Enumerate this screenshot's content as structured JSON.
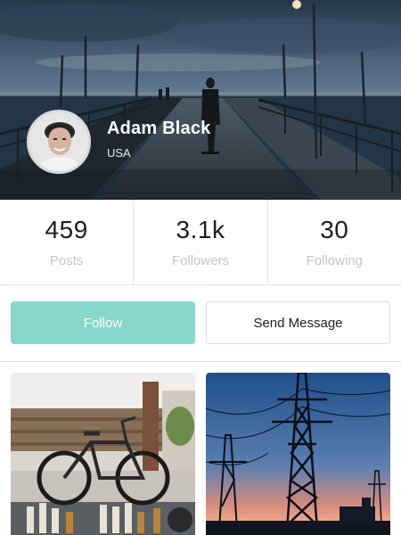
{
  "profile": {
    "name": "Adam Black",
    "location": "USA"
  },
  "stats": [
    {
      "value": "459",
      "label": "Posts"
    },
    {
      "value": "3.1k",
      "label": "Followers"
    },
    {
      "value": "30",
      "label": "Following"
    }
  ],
  "actions": {
    "follow_label": "Follow",
    "message_label": "Send Message"
  },
  "colors": {
    "accent": "#86d8cb",
    "border": "#e4e4e4",
    "muted_text": "#c4c4c4"
  }
}
